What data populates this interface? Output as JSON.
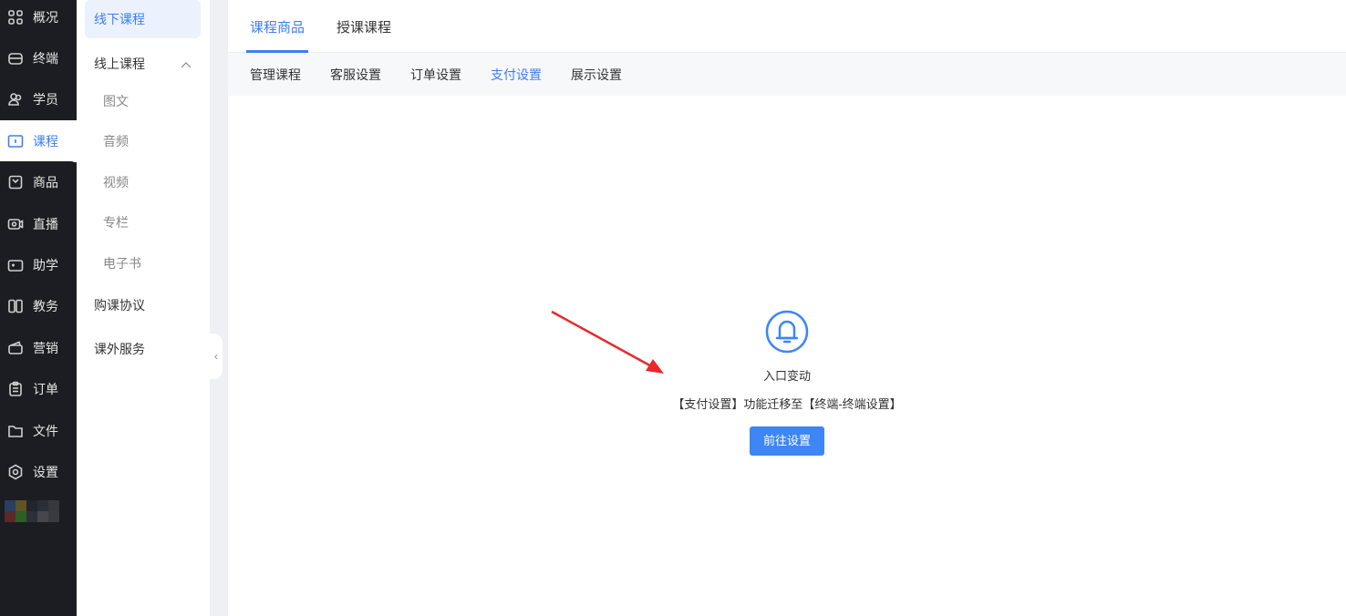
{
  "nav": {
    "items": [
      {
        "label": "概况",
        "icon": "grid-icon"
      },
      {
        "label": "终端",
        "icon": "terminal-icon"
      },
      {
        "label": "学员",
        "icon": "users-icon"
      },
      {
        "label": "课程",
        "icon": "course-icon"
      },
      {
        "label": "商品",
        "icon": "goods-icon"
      },
      {
        "label": "直播",
        "icon": "live-icon"
      },
      {
        "label": "助学",
        "icon": "gamepad-icon"
      },
      {
        "label": "教务",
        "icon": "columns-icon"
      },
      {
        "label": "营销",
        "icon": "wallet-icon"
      },
      {
        "label": "订单",
        "icon": "clipboard-icon"
      },
      {
        "label": "文件",
        "icon": "folder-icon"
      },
      {
        "label": "设置",
        "icon": "settings-icon"
      }
    ],
    "active": "课程"
  },
  "subnav": {
    "offline": "线下课程",
    "online": "线上课程",
    "children": [
      "图文",
      "音频",
      "视频",
      "专栏",
      "电子书"
    ],
    "agreement": "购课协议",
    "extra": "课外服务"
  },
  "tabs": [
    "课程商品",
    "授课课程"
  ],
  "subtabs": [
    "管理课程",
    "客服设置",
    "订单设置",
    "支付设置",
    "展示设置"
  ],
  "notice": {
    "title": "入口变动",
    "desc": "【支付设置】功能迁移至【终端-终端设置】",
    "button": "前往设置"
  },
  "colors": {
    "accent": "#3d7ff0",
    "sidebar": "#1c1d22",
    "arrow": "#e8282b"
  }
}
